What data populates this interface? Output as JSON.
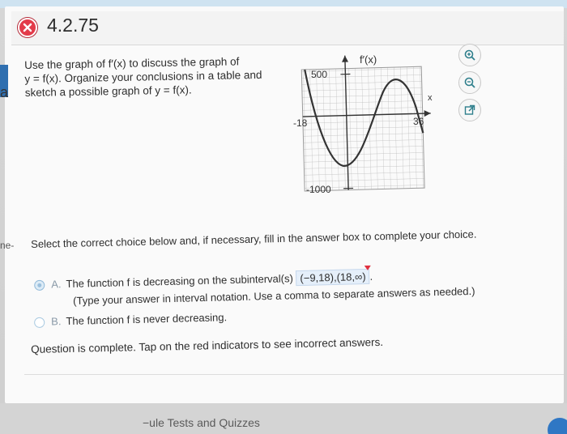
{
  "header": {
    "problem_id": "4.2.75",
    "status_icon": "x-incorrect-icon",
    "status_color": "#e33b4a"
  },
  "question": {
    "lines": [
      "Use the graph of f′(x) to discuss the graph of",
      "y = f(x). Organize your conclusions in a table and",
      "sketch a possible graph of y = f(x)."
    ]
  },
  "graph": {
    "y_axis_label": "f′(x)",
    "x_axis_label": "x",
    "y_max_label": "500",
    "y_min_label": "-1000",
    "x_min_label": "-18",
    "x_max_label": "36"
  },
  "tools": [
    {
      "name": "zoom-in-icon"
    },
    {
      "name": "zoom-out-icon"
    },
    {
      "name": "open-new-window-icon"
    }
  ],
  "side_label": "ne-",
  "side_letter": "a",
  "instructions": "Select the correct choice below and, if necessary, fill in the answer box to complete your choice.",
  "choices": {
    "a": {
      "letter": "A.",
      "prefix": "The function f is decreasing on the subinterval(s)",
      "answer": "(−9,18),(18,∞)",
      "suffix": ".",
      "note": "(Type your answer in interval notation. Use a comma to separate answers as needed.)",
      "selected": true
    },
    "b": {
      "letter": "B.",
      "text": "The function f is never decreasing.",
      "selected": false
    }
  },
  "status_message": "Question is complete. Tap on the red indicators to see incorrect answers.",
  "footer": {
    "link_label": "Tests and Quizzes",
    "link_prefix": "−ule"
  }
}
